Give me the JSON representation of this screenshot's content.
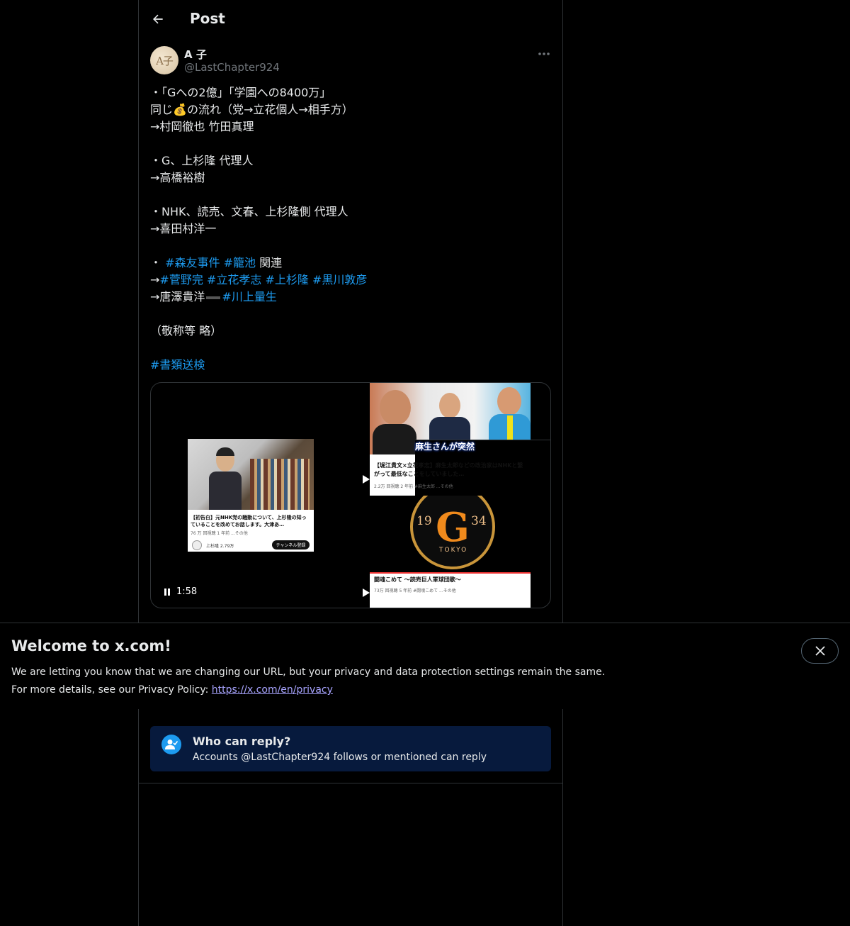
{
  "header": {
    "title": "Post"
  },
  "author": {
    "avatar_text": "A子",
    "display_name": "A 子",
    "handle": "@LastChapter924"
  },
  "post": {
    "l1": "・「Gへの2億」「学園への8400万」",
    "l2_a": "同じ",
    "l2_emoji": "💰",
    "l2_b": "の流れ（党→立花個人→相手方）",
    "l3": "→村岡徹也 竹田真理",
    "l5": "・G、上杉隆 代理人",
    "l6": "→高橋裕樹",
    "l8": "・NHK、読売、文春、上杉隆側 代理人",
    "l9": "→喜田村洋一",
    "l11_a": "・ ",
    "l11_tag1": "#森友事件",
    "l11_tag2": "#籠池",
    "l11_b": " 関連",
    "l12_arrow": "→",
    "l12_tag1": "#菅野完",
    "l12_tag2": "#立花孝志",
    "l12_tag3": "#上杉隆",
    "l12_tag4": "#黒川敦彦",
    "l13_a": "→唐澤貴洋",
    "l13_tag": "#川上量生",
    "l15": "（敬称等 略）",
    "l17_tag": "#書類送検"
  },
  "media": {
    "left_caption": "【初告白】元NHK党の騒動について、上杉隆の知っていることを改めてお話します。大津あ…",
    "left_meta": "76 万 回視聴  1 年前  ...その他",
    "left_channel": "上杉隆  2.79万",
    "left_channel_button": "チャンネル登録",
    "rt_banner": "麻生さんが突然",
    "rt_caption": "【堀江貴文×立花孝志】麻生太郎などの政治家はNHKと繋がって最低なことをしていました…",
    "rt_meta": "2.2万 回視聴  2 年前  #麻生太郎  ...その他",
    "rb_logo_left": "19",
    "rb_logo_right": "34",
    "rb_logo_bottom": "TOKYO",
    "rb_caption": "闘魂こめて 〜読売巨人軍球団歌〜",
    "rb_meta": "73万 回視聴  5 年前  #闘魂こめて  ...その他",
    "time": "1:58"
  },
  "reply": {
    "title": "Who can reply?",
    "subtitle": "Accounts @LastChapter924 follows or mentioned can reply"
  },
  "banner": {
    "title": "Welcome to x.com!",
    "line1": "We are letting you know that we are changing our URL, but your privacy and data protection settings remain the same.",
    "line2_prefix": "For more details, see our Privacy Policy: ",
    "link": "https://x.com/en/privacy"
  },
  "colors": {
    "accent": "#1d9bf0",
    "muted": "#71767b",
    "link": "#a8a4ff",
    "reply_bg": "#071a3d"
  }
}
